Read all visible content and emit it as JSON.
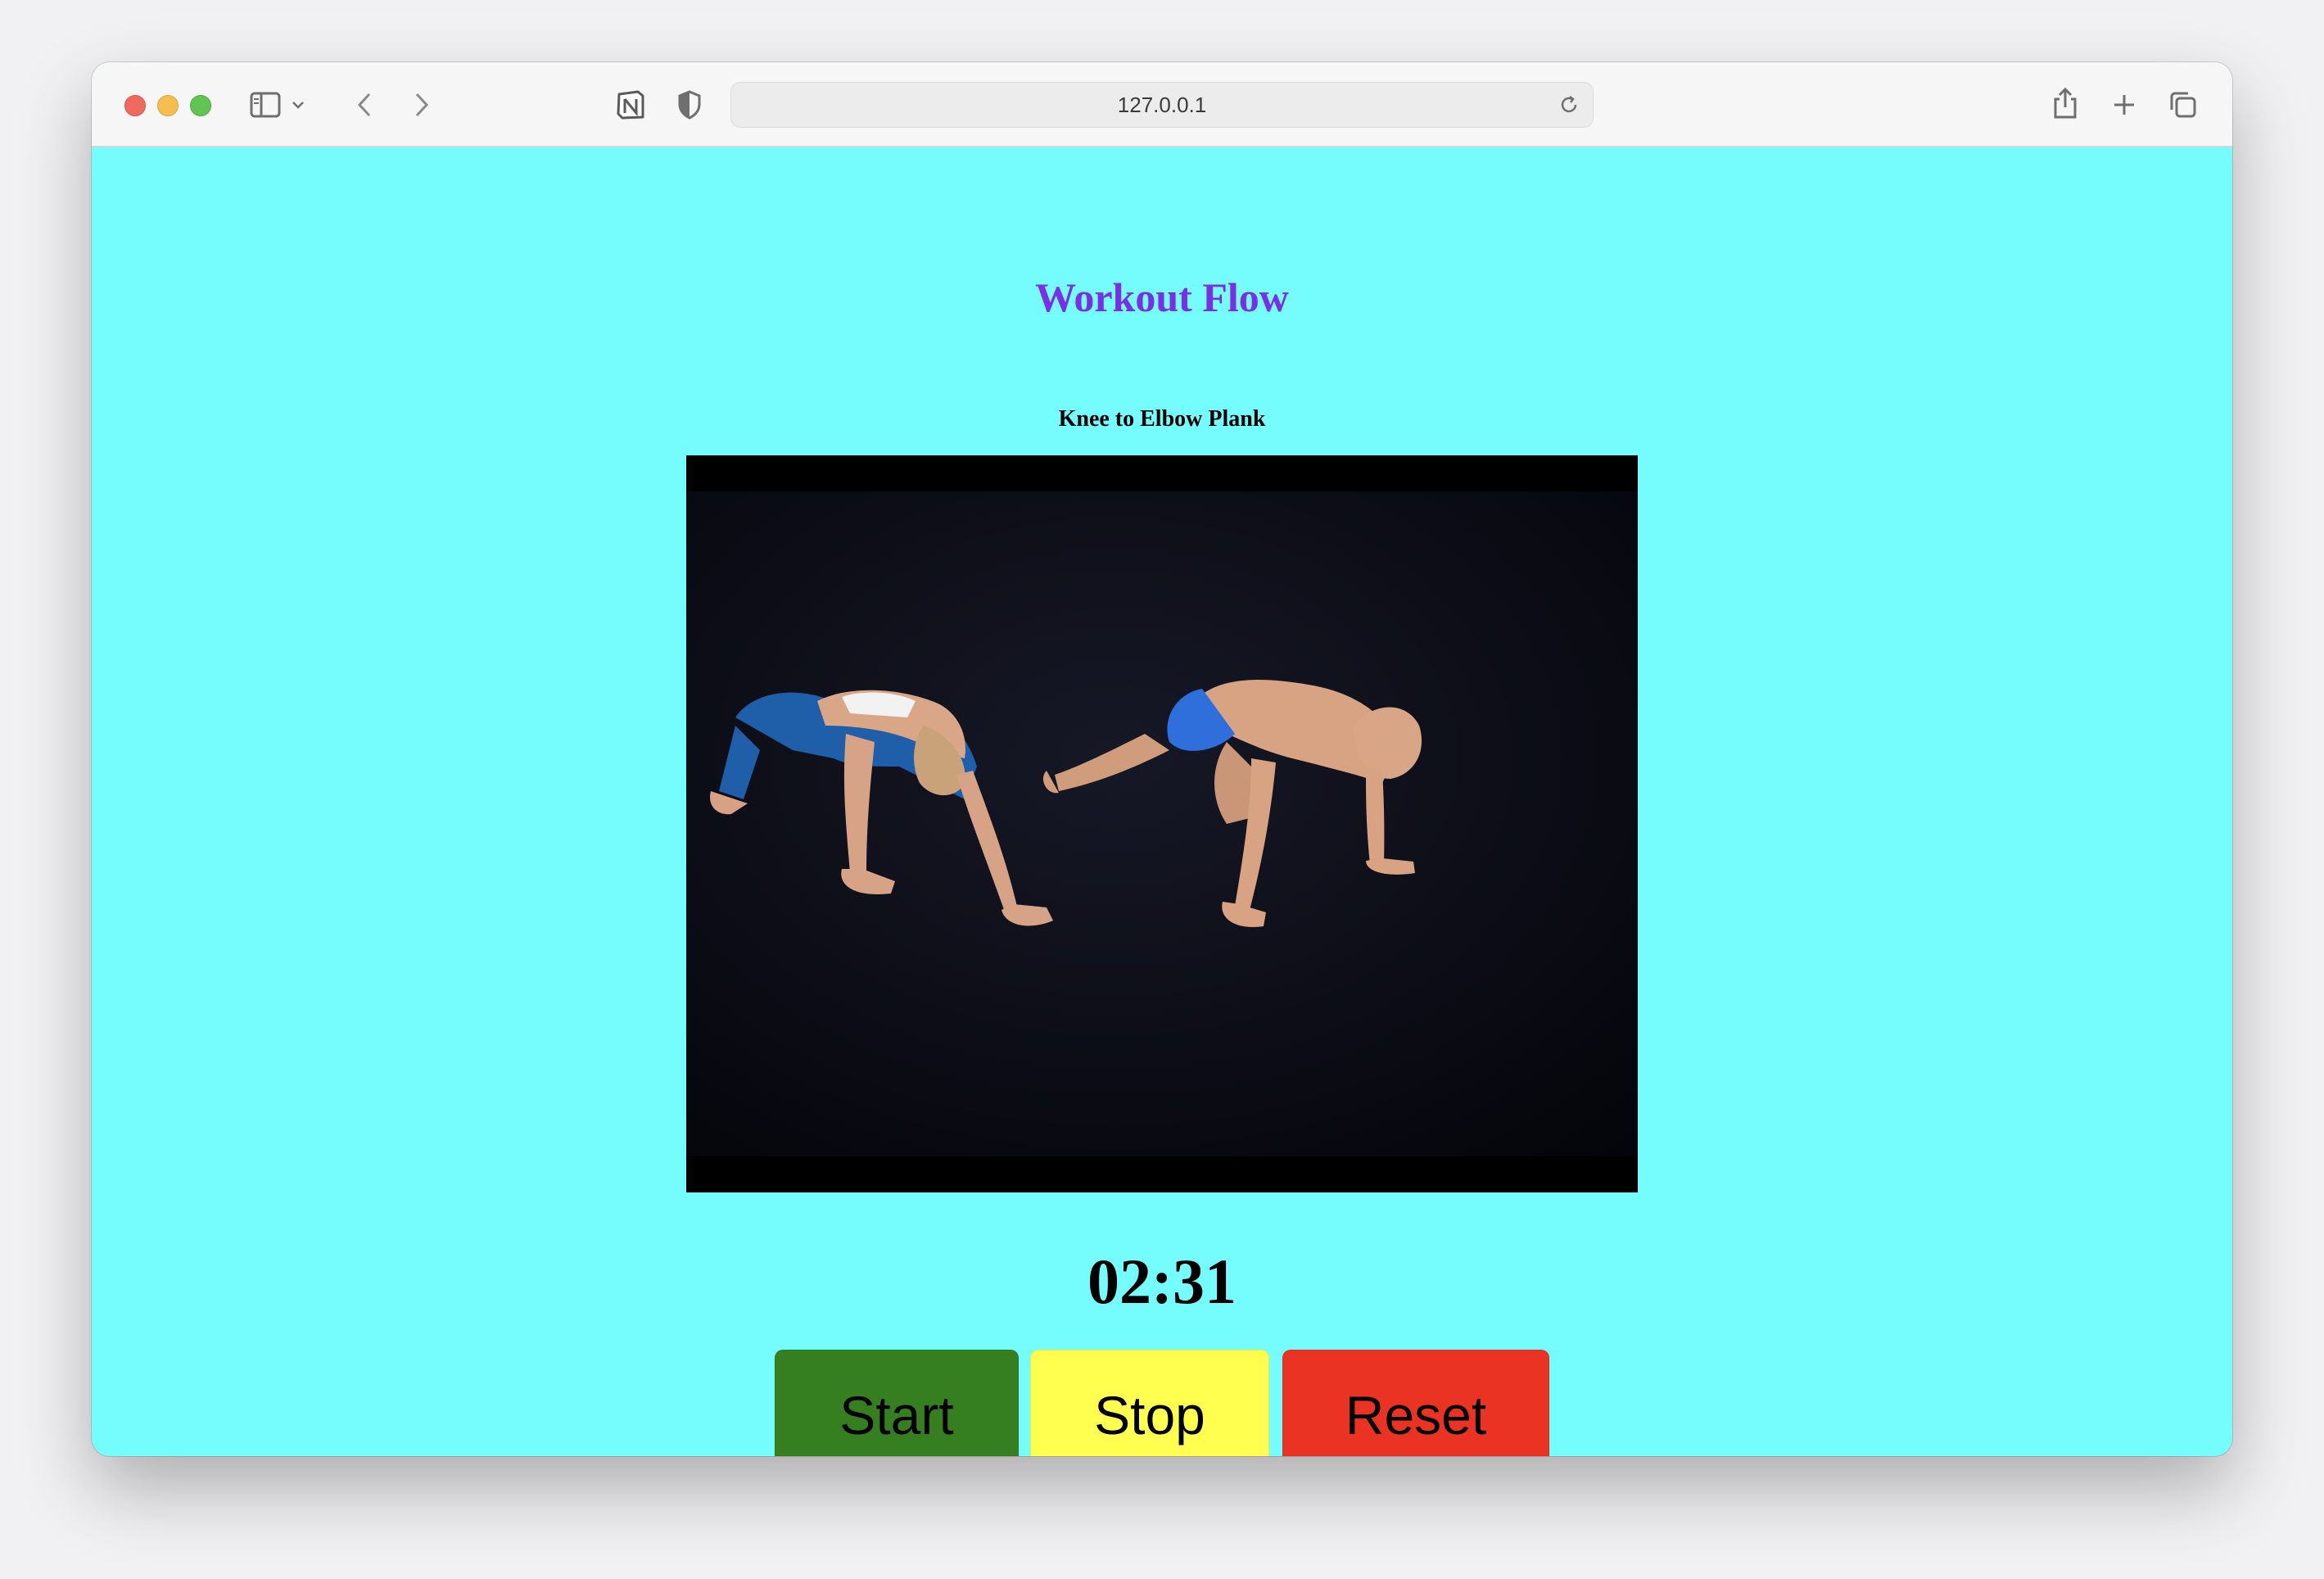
{
  "browser": {
    "address": "127.0.0.1",
    "icons": {
      "sidebar": "sidebar-icon",
      "chevron": "chevron-down-icon",
      "back": "back-arrow-icon",
      "forward": "forward-arrow-icon",
      "notion": "notion-icon",
      "shield": "shield-icon",
      "reload": "reload-icon",
      "share": "share-icon",
      "new_tab": "plus-icon",
      "tabs": "tabs-overview-icon"
    }
  },
  "page": {
    "title": "Workout Flow",
    "exercise_name": "Knee to Elbow Plank",
    "timer": "02:31",
    "buttons": {
      "start": "Start",
      "stop": "Stop",
      "reset": "Reset"
    },
    "colors": {
      "background": "#75fdfd",
      "title": "#7a2ee6",
      "start": "#367f20",
      "stop": "#ffff4f",
      "reset": "#ea3323"
    }
  }
}
